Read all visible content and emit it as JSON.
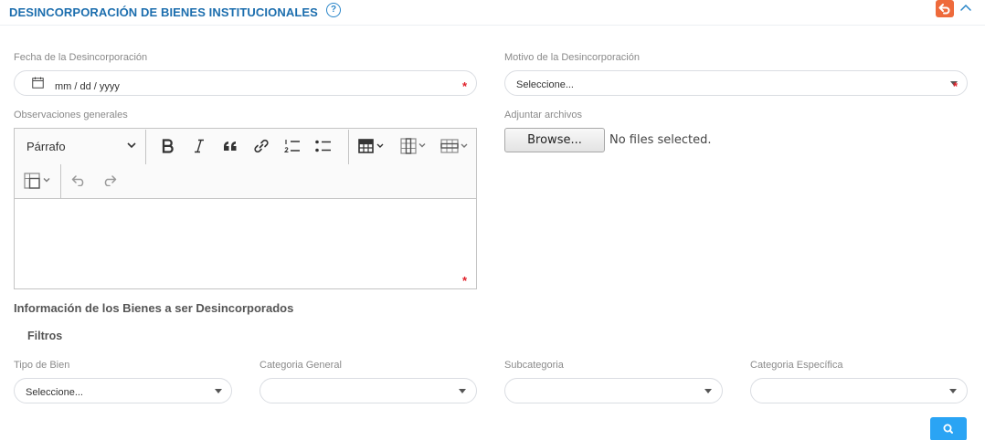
{
  "header": {
    "title": "DESINCORPORACIÓN DE BIENES INSTITUCIONALES",
    "help_glyph": "?"
  },
  "form": {
    "date_label": "Fecha de la Desincorporación",
    "date_placeholder": "mm / dd / yyyy",
    "reason_label": "Motivo de la Desincorporación",
    "reason_value": "Seleccione...",
    "observations_label": "Observaciones generales",
    "attachments_label": "Adjuntar archivos",
    "browse_label": "Browse...",
    "file_status": "No files selected.",
    "required_mark": "*"
  },
  "editor": {
    "heading_value": "Párrafo",
    "tools": [
      "bold",
      "italic",
      "blockquote",
      "link",
      "numbered-list",
      "bulleted-list",
      "insert-table",
      "table-column",
      "table-row",
      "merge-cells",
      "undo",
      "redo"
    ]
  },
  "assets": {
    "section_title": "Información de los Bienes a ser Desincorporados",
    "filters_title": "Filtros",
    "filters": [
      {
        "label": "Tipo de Bien",
        "value": "Seleccione..."
      },
      {
        "label": "Categoria General",
        "value": ""
      },
      {
        "label": "Subcategoria",
        "value": ""
      },
      {
        "label": "Categoria Específica",
        "value": ""
      }
    ]
  },
  "colors": {
    "title_blue": "#1c6eae",
    "back_orange": "#ee6a3b",
    "search_blue": "#2aa4f4",
    "required_red": "#e0202a"
  },
  "icons": [
    "help-icon",
    "undo-arrow-icon",
    "chevron-up-icon",
    "calendar-icon",
    "search-icon"
  ]
}
